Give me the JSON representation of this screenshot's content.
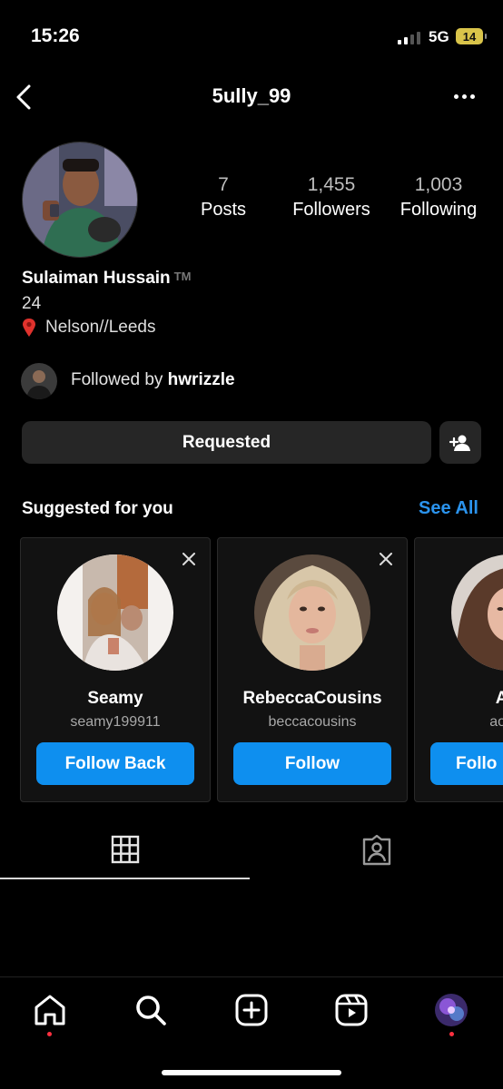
{
  "status": {
    "time": "15:26",
    "network": "5G",
    "battery": "14"
  },
  "header": {
    "username": "5ully_99"
  },
  "profile": {
    "stats": [
      {
        "value": "7",
        "label": "Posts"
      },
      {
        "value": "1,455",
        "label": "Followers"
      },
      {
        "value": "1,003",
        "label": "Following"
      }
    ],
    "name": "Sulaiman Hussain",
    "name_suffix": "TM",
    "age": "24",
    "location": "Nelson//Leeds",
    "followed_by_prefix": "Followed by",
    "followed_by_user": "hwrizzle",
    "request_button": "Requested"
  },
  "suggested": {
    "title": "Suggested for you",
    "see_all": "See All",
    "cards": [
      {
        "name": "Seamy",
        "username": "seamy199911",
        "button": "Follow Back"
      },
      {
        "name": "RebeccaCousins",
        "username": "beccacousins",
        "button": "Follow"
      },
      {
        "name": "Aói",
        "username": "aoife_",
        "button": "Follo"
      }
    ]
  },
  "icons": {
    "back": "chevron-left-icon",
    "more": "more-icon",
    "add_person": "add-person-icon",
    "grid": "grid-icon",
    "tagged": "tagged-icon",
    "home": "home-icon",
    "search": "search-icon",
    "create": "plus-square-icon",
    "reels": "reels-icon"
  },
  "colors": {
    "accent": "#0e8fef",
    "link": "#2b94ee",
    "notification_dot": "#ff3040"
  }
}
